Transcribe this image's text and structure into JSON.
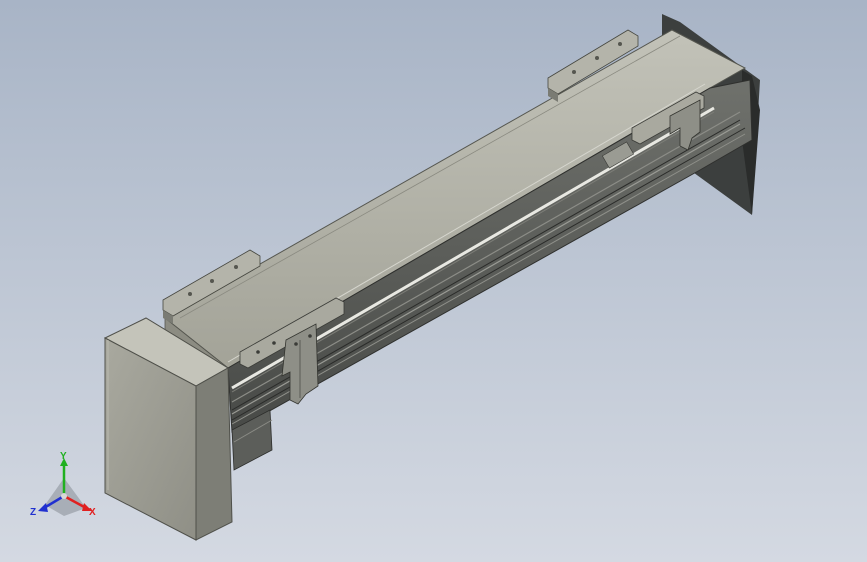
{
  "viewport": {
    "model": "linear-actuator-module",
    "background_top": "#a8b4c6",
    "background_bottom": "#d4d9e2",
    "body_color": "#a6a69c",
    "dark_color": "#3a3d3c"
  },
  "triad": {
    "x_label": "X",
    "y_label": "Y",
    "z_label": "Z",
    "x_color": "#e02020",
    "y_color": "#20b020",
    "z_color": "#2030d0"
  }
}
